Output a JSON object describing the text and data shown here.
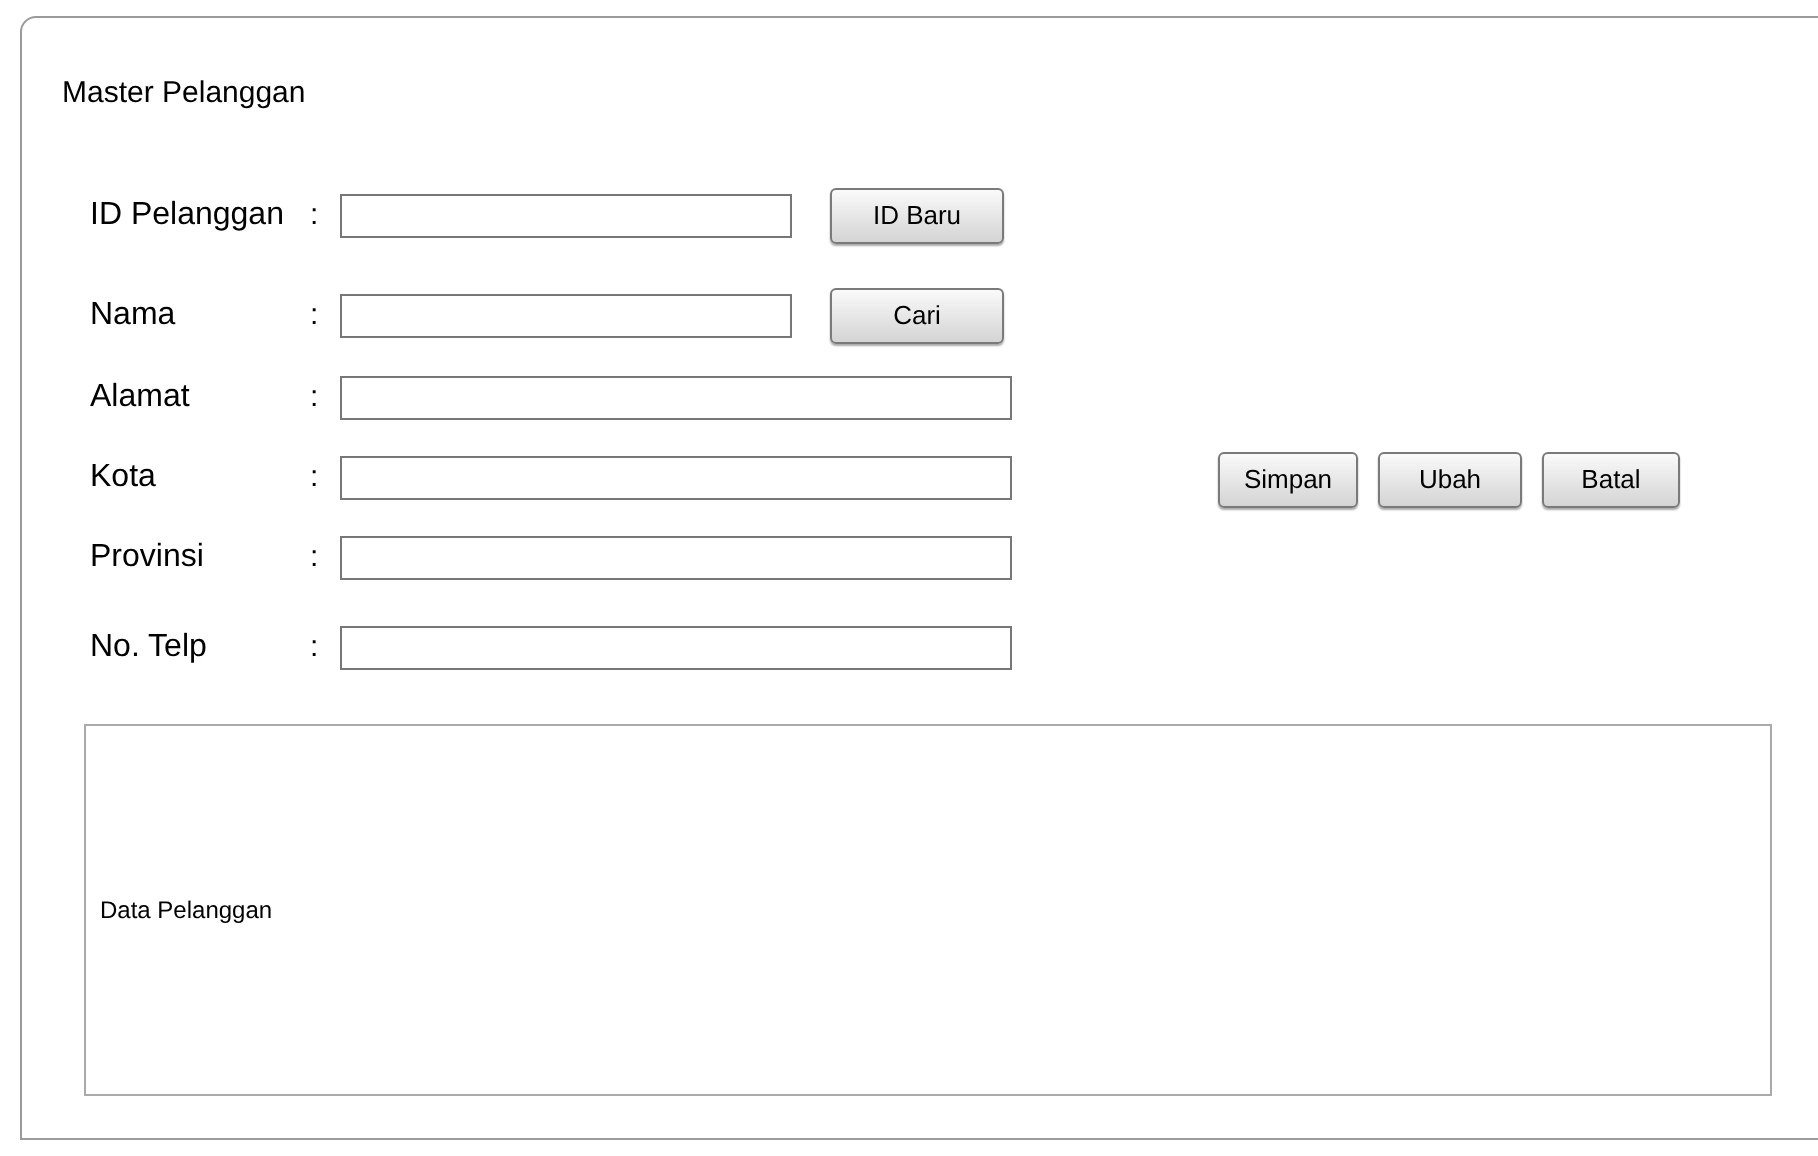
{
  "window": {
    "title": "Master Pelanggan"
  },
  "fields": [
    {
      "label": "ID Pelanggan",
      "colon": ":",
      "button": "ID Baru"
    },
    {
      "label": "Nama",
      "colon": ":",
      "button": "Cari"
    },
    {
      "label": "Alamat",
      "colon": ":"
    },
    {
      "label": "Kota",
      "colon": ":"
    },
    {
      "label": "Provinsi",
      "colon": ":"
    },
    {
      "label": "No. Telp",
      "colon": ":"
    }
  ],
  "actions": [
    "Simpan",
    "Ubah",
    "Batal"
  ],
  "table": {
    "title": "Data Pelanggan"
  }
}
